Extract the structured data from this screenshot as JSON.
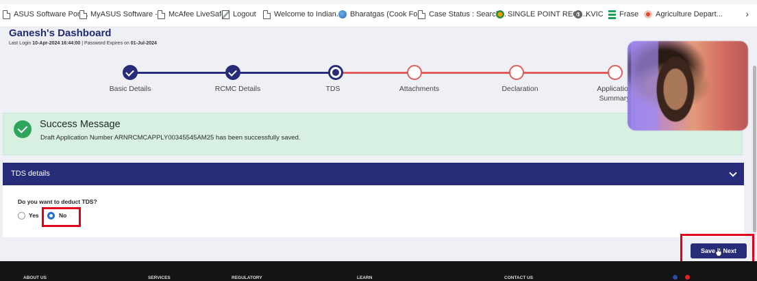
{
  "bookmarks": [
    {
      "label": "ASUS Software Port...",
      "icon": "doc-icon"
    },
    {
      "label": "MyASUS Software -...",
      "icon": "doc-icon"
    },
    {
      "label": "McAfee LiveSafe",
      "icon": "doc-icon"
    },
    {
      "label": "Logout",
      "icon": "image-icon"
    },
    {
      "label": "Welcome to Indian...",
      "icon": "doc-icon"
    },
    {
      "label": "Bharatgas (Cook Fo...",
      "icon": "globe-icon"
    },
    {
      "label": "Case Status : Search...",
      "icon": "doc-icon"
    },
    {
      "label": "SINGLE POINT REGI...",
      "icon": "emblem-icon"
    },
    {
      "label": "KVIC",
      "icon": "gear-icon"
    },
    {
      "label": "Frase",
      "icon": "frase-icon"
    },
    {
      "label": "Agriculture Depart...",
      "icon": "emblem-icon"
    }
  ],
  "header": {
    "title": "Ganesh's Dashboard",
    "last_login_label": "Last Login",
    "last_login_value": "10-Apr-2024 16:44:00",
    "separator": "|",
    "password_label": "Password Expires on",
    "password_value": "01-Jul-2024"
  },
  "stepper": {
    "steps": [
      {
        "label": "Basic Details",
        "state": "done"
      },
      {
        "label": "RCMC Details",
        "state": "done"
      },
      {
        "label": "TDS",
        "state": "current"
      },
      {
        "label": "Attachments",
        "state": "todo"
      },
      {
        "label": "Declaration",
        "state": "todo"
      },
      {
        "label": "Application Summary",
        "state": "todo"
      }
    ]
  },
  "success": {
    "title": "Success Message",
    "text": "Draft Application Number ARNRCMCAPPLY00345545AM25 has been successfully saved."
  },
  "tds": {
    "section_title": "TDS details",
    "question": "Do you want to deduct TDS?",
    "options": [
      {
        "label": "Yes",
        "selected": false
      },
      {
        "label": "No",
        "selected": true
      }
    ]
  },
  "actions": {
    "save_next": "Save & Next"
  },
  "footer": {
    "columns": [
      "ABOUT US",
      "SERVICES",
      "REGULATORY",
      "LEARN",
      "CONTACT US"
    ]
  },
  "colors": {
    "primary": "#262c78",
    "pending": "#e35b5b",
    "success_bg": "#d7f0e2",
    "success_icon": "#2ea55b",
    "highlight": "#e0001b"
  }
}
